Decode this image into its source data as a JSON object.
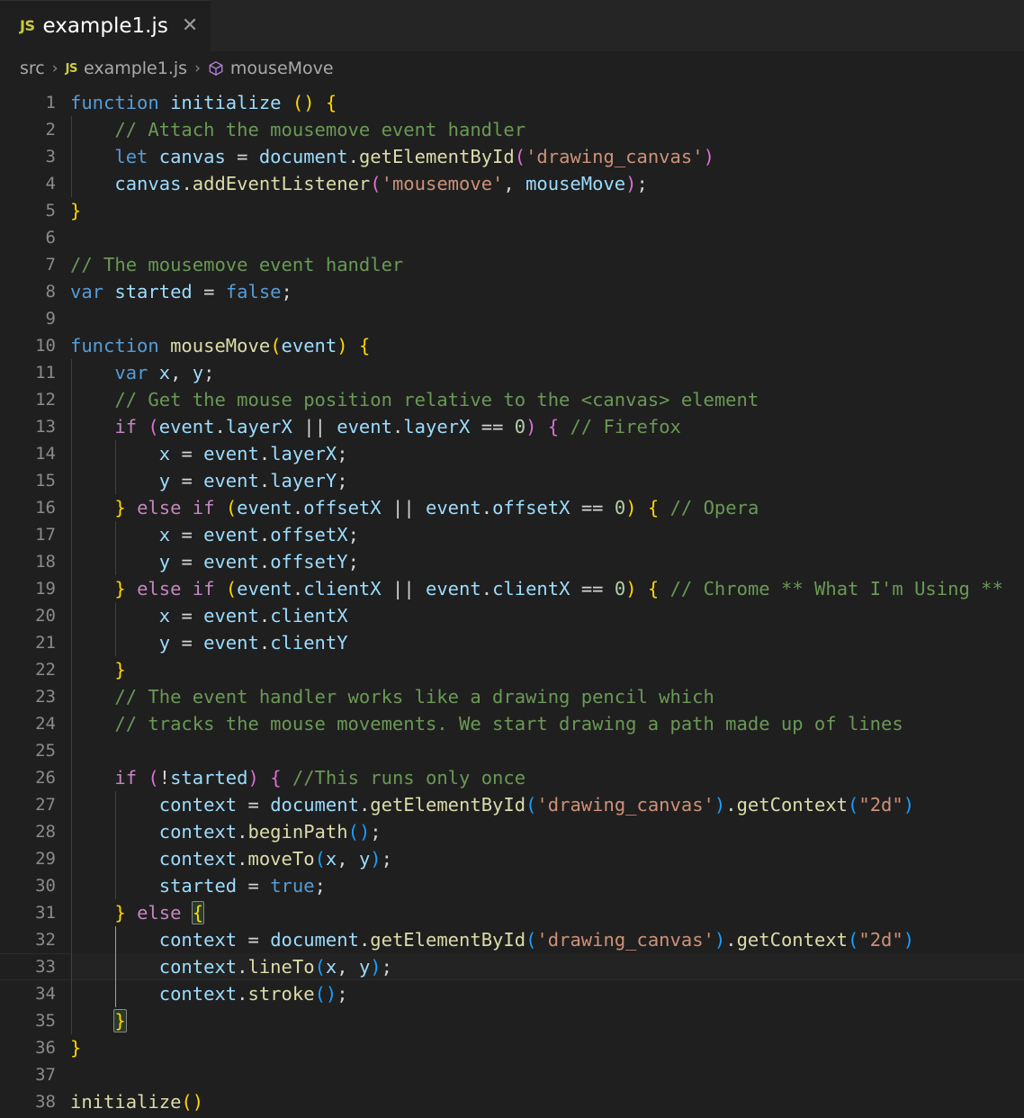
{
  "window": {
    "background": "#1f1f1f",
    "tabbar_background": "#252526"
  },
  "tabbar": {
    "tabs": [
      {
        "file_icon_label": "JS",
        "label": "example1.js",
        "close_label": "✕",
        "active": true
      }
    ]
  },
  "breadcrumb": {
    "separator": "›",
    "items": [
      {
        "label": "src",
        "icon": "none"
      },
      {
        "label": "example1.js",
        "icon": "js-icon",
        "icon_label": "JS"
      },
      {
        "label": "mouseMove",
        "icon": "symbol-method-icon"
      }
    ]
  },
  "editor": {
    "language": "javascript",
    "theme": "Dark Modern",
    "active_line": 33,
    "font_size_px": 20.5,
    "line_height_px": 30,
    "colors": {
      "keyword": "#569cd6",
      "control": "#c586c0",
      "function": "#dcdcaa",
      "variable": "#9cdcfe",
      "string": "#ce9178",
      "comment": "#6a9955",
      "number": "#b5cea8",
      "operator": "#d4d4d4",
      "bracket_level_1": "#ffd700",
      "bracket_level_2": "#da70d6",
      "bracket_level_3": "#179fff",
      "line_number": "#8b8b8b",
      "indent_guide": "#404040",
      "active_indent_guide": "#c586c0"
    },
    "lines": [
      {
        "n": 1,
        "guides": [],
        "text": "function initialize () {"
      },
      {
        "n": 2,
        "guides": [
          0
        ],
        "text": "    // Attach the mousemove event handler"
      },
      {
        "n": 3,
        "guides": [
          0
        ],
        "text": "    let canvas = document.getElementById('drawing_canvas')"
      },
      {
        "n": 4,
        "guides": [
          0
        ],
        "text": "    canvas.addEventListener('mousemove', mouseMove);"
      },
      {
        "n": 5,
        "guides": [],
        "text": "}"
      },
      {
        "n": 6,
        "guides": [],
        "text": ""
      },
      {
        "n": 7,
        "guides": [],
        "text": "// The mousemove event handler"
      },
      {
        "n": 8,
        "guides": [],
        "text": "var started = false;"
      },
      {
        "n": 9,
        "guides": [],
        "text": ""
      },
      {
        "n": 10,
        "guides": [],
        "text": "function mouseMove(event) {"
      },
      {
        "n": 11,
        "guides": [
          0
        ],
        "text": "    var x, y;"
      },
      {
        "n": 12,
        "guides": [
          0
        ],
        "text": "    // Get the mouse position relative to the <canvas> element"
      },
      {
        "n": 13,
        "guides": [
          0
        ],
        "text": "    if (event.layerX || event.layerX == 0) { // Firefox"
      },
      {
        "n": 14,
        "guides": [
          0,
          1
        ],
        "text": "        x = event.layerX;"
      },
      {
        "n": 15,
        "guides": [
          0,
          1
        ],
        "text": "        y = event.layerY;"
      },
      {
        "n": 16,
        "guides": [
          0
        ],
        "text": "    } else if (event.offsetX || event.offsetX == 0) { // Opera"
      },
      {
        "n": 17,
        "guides": [
          0,
          1
        ],
        "text": "        x = event.offsetX;"
      },
      {
        "n": 18,
        "guides": [
          0,
          1
        ],
        "text": "        y = event.offsetY;"
      },
      {
        "n": 19,
        "guides": [
          0
        ],
        "text": "    } else if (event.clientX || event.clientX == 0) { // Chrome ** What I'm Using **"
      },
      {
        "n": 20,
        "guides": [
          0,
          1
        ],
        "text": "        x = event.clientX"
      },
      {
        "n": 21,
        "guides": [
          0,
          1
        ],
        "text": "        y = event.clientY"
      },
      {
        "n": 22,
        "guides": [
          0
        ],
        "text": "    }"
      },
      {
        "n": 23,
        "guides": [
          0
        ],
        "text": "    // The event handler works like a drawing pencil which"
      },
      {
        "n": 24,
        "guides": [
          0
        ],
        "text": "    // tracks the mouse movements. We start drawing a path made up of lines"
      },
      {
        "n": 25,
        "guides": [
          0
        ],
        "text": ""
      },
      {
        "n": 26,
        "guides": [
          0
        ],
        "text": "    if (!started) { //This runs only once"
      },
      {
        "n": 27,
        "guides": [
          0,
          1
        ],
        "text": "        context = document.getElementById('drawing_canvas').getContext(\"2d\")"
      },
      {
        "n": 28,
        "guides": [
          0,
          1
        ],
        "text": "        context.beginPath();"
      },
      {
        "n": 29,
        "guides": [
          0,
          1
        ],
        "text": "        context.moveTo(x, y);"
      },
      {
        "n": 30,
        "guides": [
          0,
          1
        ],
        "text": "        started = true;"
      },
      {
        "n": 31,
        "guides": [
          0
        ],
        "text": "    } else {"
      },
      {
        "n": 32,
        "guides": [
          0,
          1
        ],
        "text": "        context = document.getElementById('drawing_canvas').getContext(\"2d\")"
      },
      {
        "n": 33,
        "guides": [
          0,
          1
        ],
        "text": "        context.lineTo(x, y);"
      },
      {
        "n": 34,
        "guides": [
          0,
          1
        ],
        "text": "        context.stroke();"
      },
      {
        "n": 35,
        "guides": [
          0
        ],
        "text": "    }"
      },
      {
        "n": 36,
        "guides": [],
        "text": "}"
      },
      {
        "n": 37,
        "guides": [],
        "text": ""
      },
      {
        "n": 38,
        "guides": [],
        "text": "initialize()"
      }
    ]
  }
}
